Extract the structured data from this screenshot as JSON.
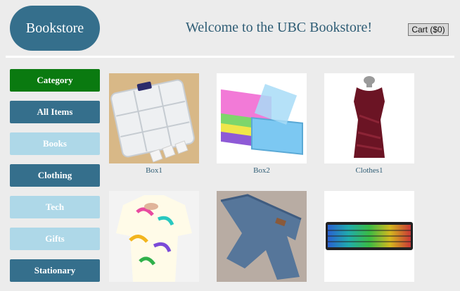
{
  "header": {
    "logo": "Bookstore",
    "welcome": "Welcome to the UBC Bookstore!",
    "cart": "Cart ($0)"
  },
  "sidebar": {
    "items": [
      {
        "label": "Category"
      },
      {
        "label": "All Items"
      },
      {
        "label": "Books"
      },
      {
        "label": "Clothing"
      },
      {
        "label": "Tech"
      },
      {
        "label": "Gifts"
      },
      {
        "label": "Stationary"
      }
    ]
  },
  "products": [
    {
      "name": "Box1"
    },
    {
      "name": "Box2"
    },
    {
      "name": "Clothes1"
    },
    {
      "name": ""
    },
    {
      "name": ""
    },
    {
      "name": ""
    }
  ],
  "colors": {
    "brand": "#356f8c",
    "category": "#0a7a10",
    "light": "#aed8e8",
    "background": "#ececec"
  }
}
